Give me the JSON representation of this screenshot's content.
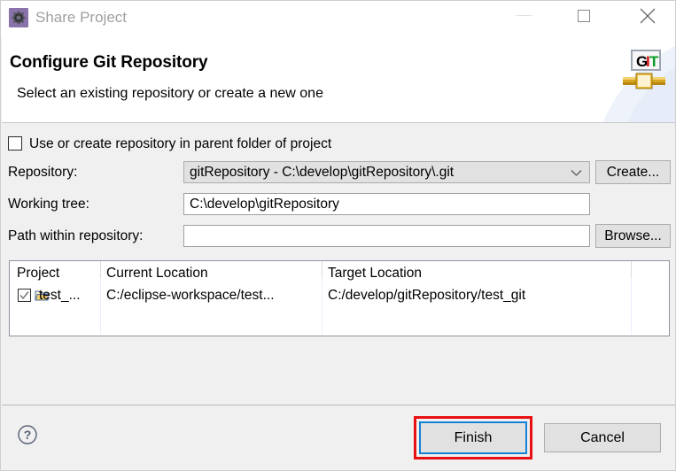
{
  "window": {
    "title": "Share Project",
    "icon": "share-project-gear-icon",
    "controls": {
      "minimize": "Minimize",
      "maximize": "Maximize",
      "close": "Close"
    }
  },
  "header": {
    "title": "Configure Git Repository",
    "subtitle": "Select an existing repository or create a new one",
    "logo_text_g": "G",
    "logo_text_i": "I",
    "logo_text_t": "T",
    "logo_alt": "git-logo"
  },
  "form": {
    "parent_folder_checkbox": {
      "label": "Use or create repository in parent folder of project",
      "checked": false
    },
    "fields": [
      {
        "label": "Repository:",
        "value": "gitRepository - C:\\develop\\gitRepository\\.git",
        "type": "combobox",
        "button": "Create..."
      },
      {
        "label": "Working tree:",
        "value": "C:\\develop\\gitRepository",
        "type": "text",
        "button": ""
      },
      {
        "label": "Path within repository:",
        "value": "",
        "placeholder": "",
        "type": "text",
        "button": "Browse..."
      }
    ],
    "repository_label": "Repository:",
    "repository_value": "gitRepository - C:\\develop\\gitRepository\\.git",
    "create_button": "Create...",
    "working_tree_label": "Working tree:",
    "working_tree_value": "C:\\develop\\gitRepository",
    "path_label": "Path within repository:",
    "path_value": "",
    "browse_button": "Browse..."
  },
  "table": {
    "columns": [
      "Project",
      "Current Location",
      "Target Location",
      ""
    ],
    "rows": [
      {
        "checked": true,
        "icon": "folder-icon",
        "project": "test_...",
        "current_location": "C:/eclipse-workspace/test...",
        "target_location": "C:/develop/gitRepository/test_git",
        "extra": ""
      }
    ]
  },
  "footer": {
    "help_label": "?",
    "finish_button": "Finish",
    "cancel_button": "Cancel"
  },
  "colors": {
    "highlight_annotation": "#e81010",
    "focus_border": "#1383d6",
    "dialog_background": "#f0f0f0",
    "header_background": "#ffffff",
    "title_text": "#a0a0a0",
    "app_icon": "#8a72ab"
  }
}
